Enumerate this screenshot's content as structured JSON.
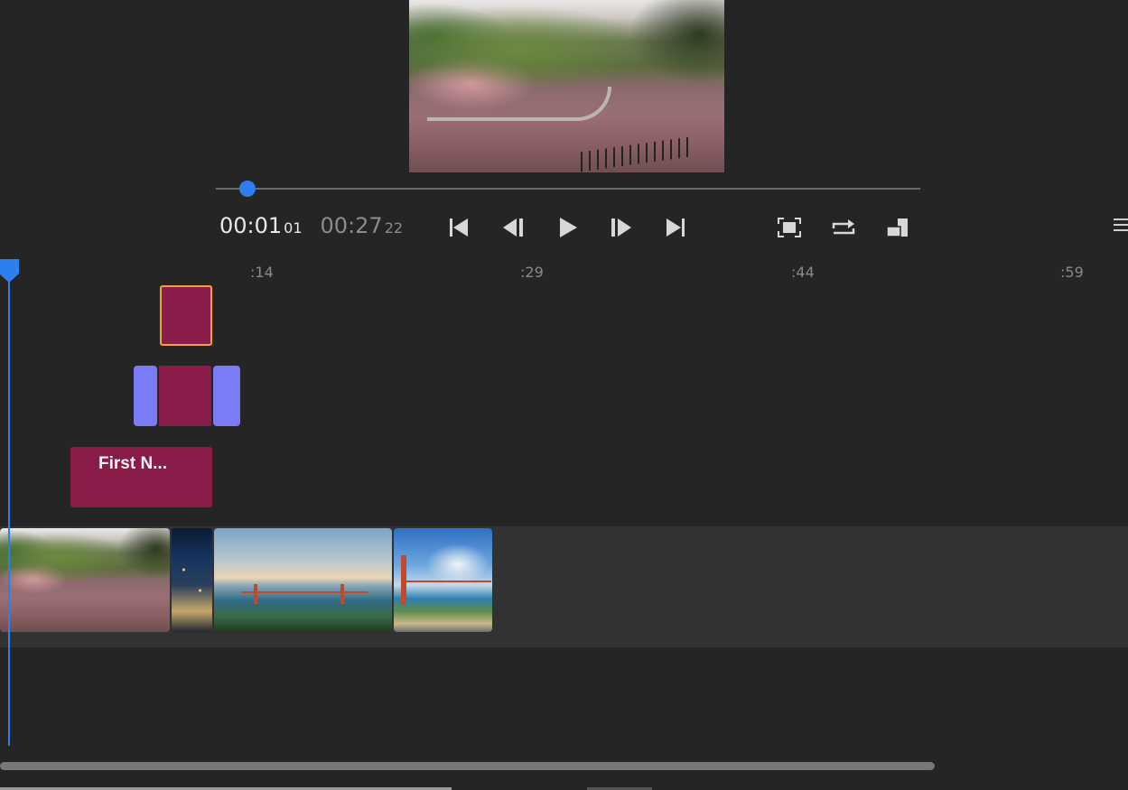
{
  "preview": {
    "icon": "video-preview-frame"
  },
  "scrubber": {
    "progress": 0.045
  },
  "timecode": {
    "current": "00:01",
    "current_frames": "01",
    "duration": "00:27",
    "duration_frames": "22"
  },
  "transport": {
    "icons": [
      "skip-to-start-icon",
      "step-back-icon",
      "play-icon",
      "step-forward-icon",
      "skip-to-end-icon"
    ]
  },
  "view_controls": {
    "icons": [
      "fit-to-screen-icon",
      "loop-icon",
      "aspect-ratio-icon",
      "menu-icon"
    ]
  },
  "ruler": {
    "ticks": [
      ":14",
      ":29",
      ":44",
      ":59"
    ]
  },
  "timeline": {
    "title_clip_label": "First N...",
    "colors": {
      "clip": "#8a1c49",
      "selected_border": "#f0a23a",
      "transition": "#7b7cf5",
      "playhead": "#2d7ff0",
      "track_bg": "#323232"
    }
  }
}
